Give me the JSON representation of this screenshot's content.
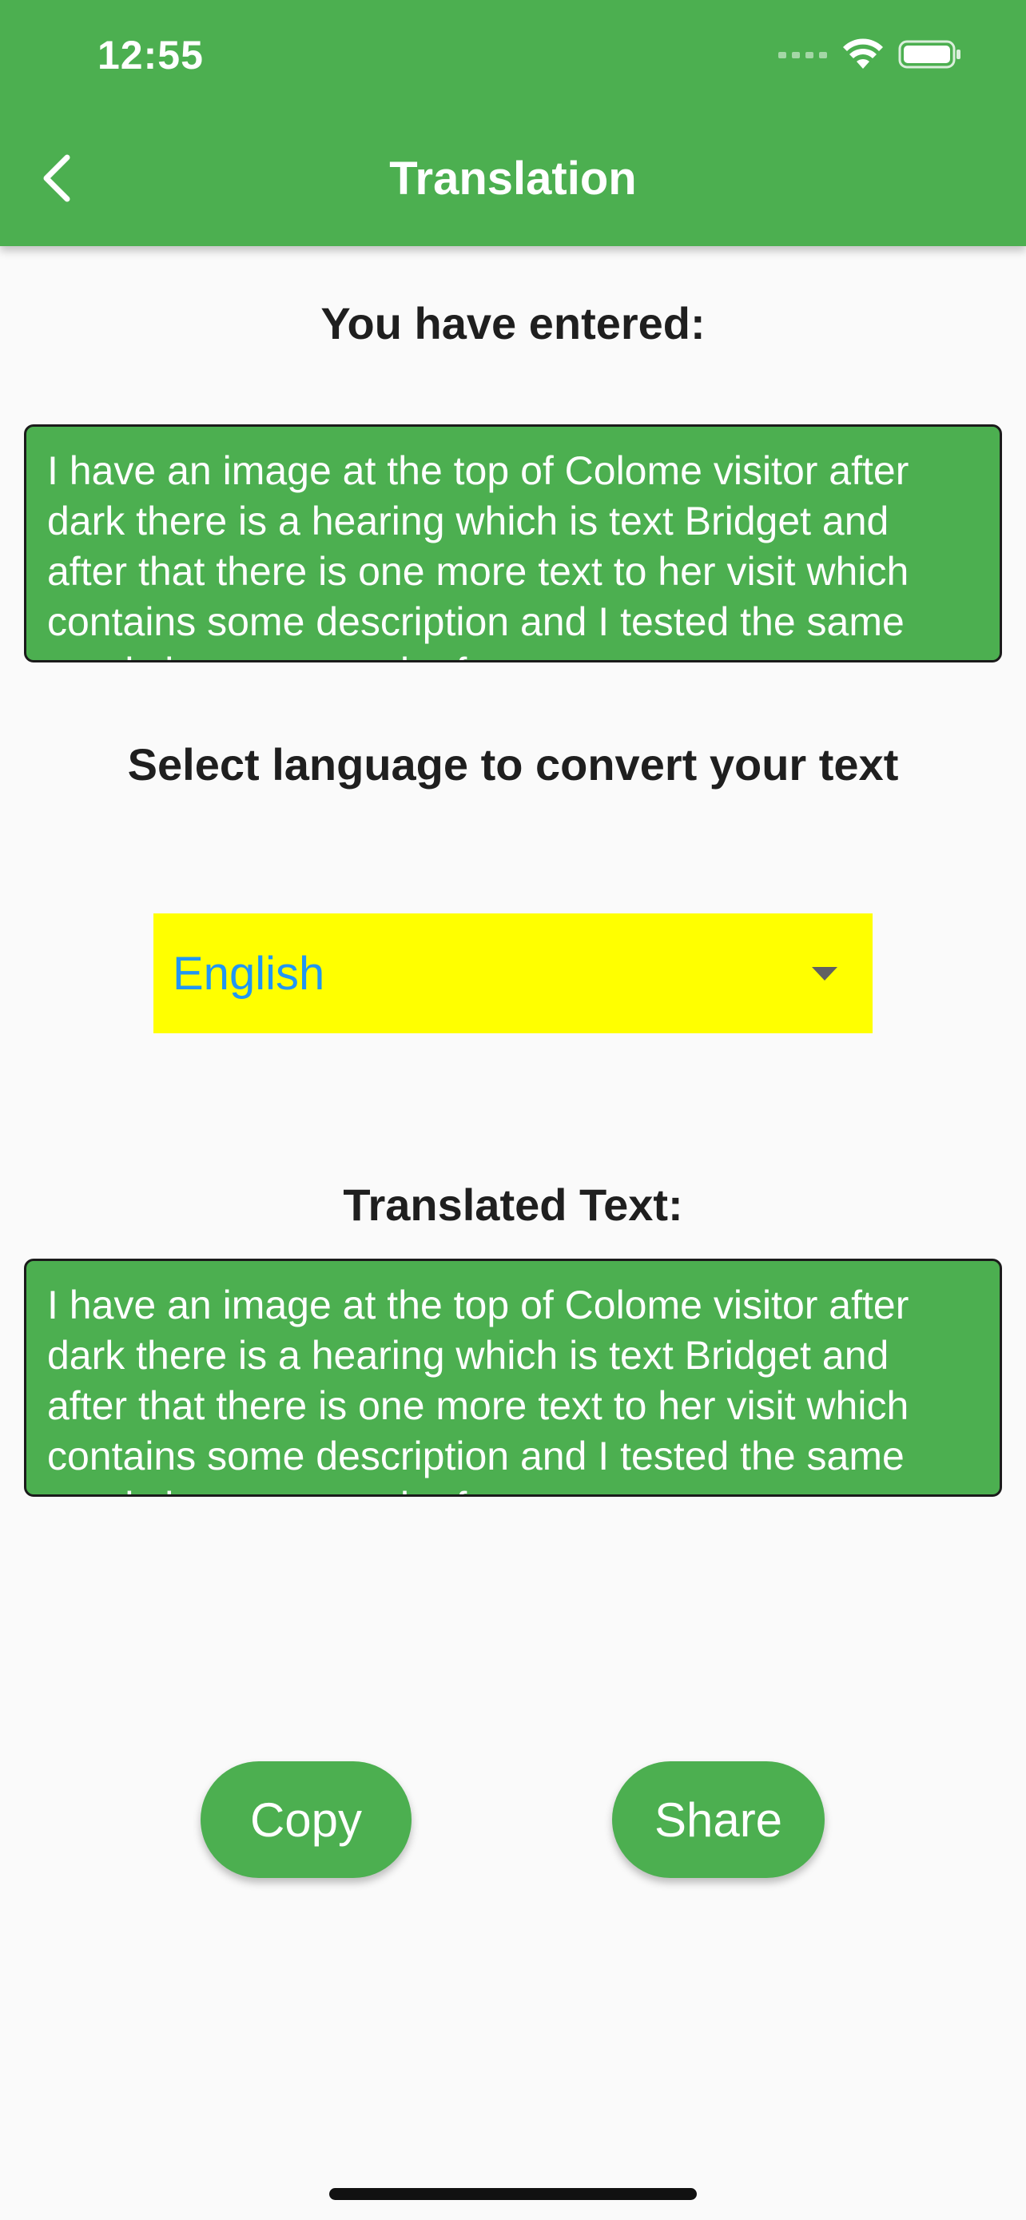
{
  "status_bar": {
    "time": "12:55"
  },
  "appbar": {
    "title": "Translation"
  },
  "input_section": {
    "heading": "You have entered:",
    "text": "I have an image at the top of Colome visitor after dark there is a hearing which is text Bridget and after that there is one more text to her visit which contains some description and I tested the same words in a paragraph of"
  },
  "language_section": {
    "heading": "Select language to convert your text",
    "selected_language": "English"
  },
  "output_section": {
    "heading": "Translated Text:",
    "text": "I have an image at the top of Colome visitor after dark there is a hearing which is text Bridget and after that there is one more text to her visit which contains some description and I tested the same words in a paragraph of"
  },
  "actions": {
    "copy_label": "Copy",
    "share_label": "Share"
  },
  "colors": {
    "primary": "#4caf50",
    "dropdown_bg": "#ffff00",
    "dropdown_text": "#2196f3"
  }
}
